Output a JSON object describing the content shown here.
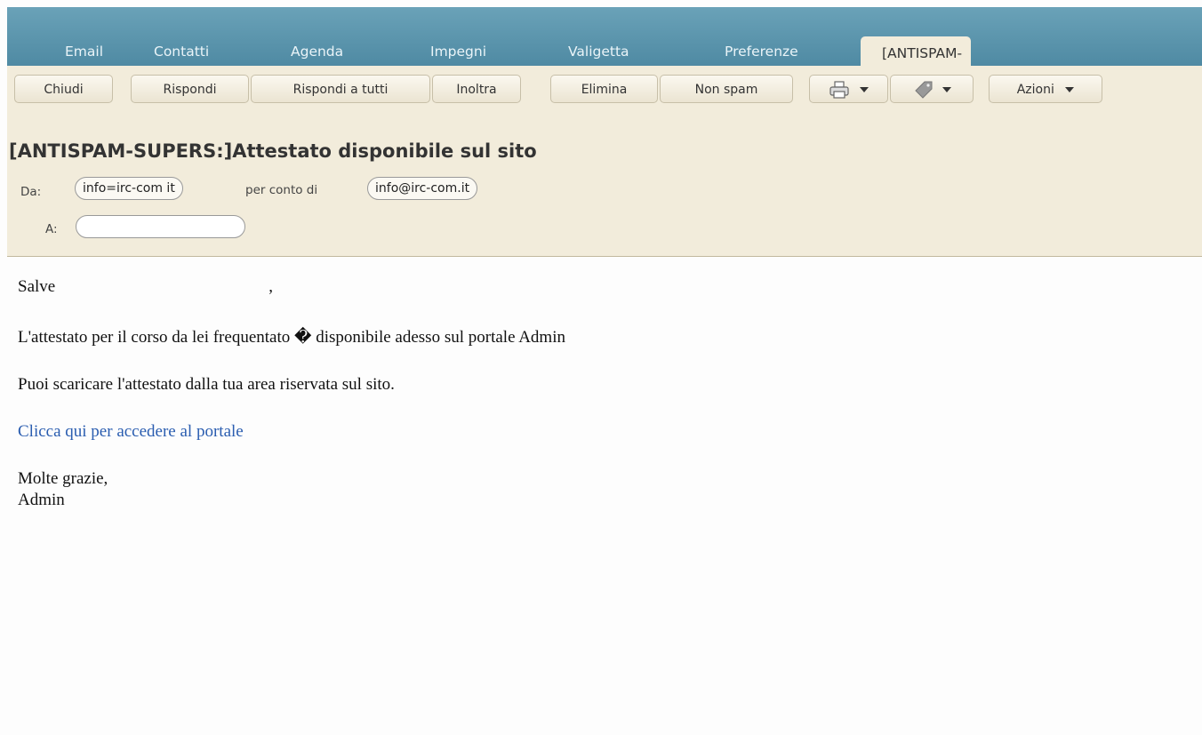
{
  "tabs": [
    {
      "label": "Email"
    },
    {
      "label": "Contatti"
    },
    {
      "label": "Agenda"
    },
    {
      "label": "Impegni"
    },
    {
      "label": "Valigetta"
    },
    {
      "label": "Preferenze"
    }
  ],
  "active_tab": {
    "label": "[ANTISPAM-SUPER"
  },
  "toolbar": {
    "close": "Chiudi",
    "reply": "Rispondi",
    "reply_all": "Rispondi a tutti",
    "forward": "Inoltra",
    "delete": "Elimina",
    "not_spam": "Non spam",
    "print_icon": "printer-icon",
    "tag_icon": "tag-icon",
    "actions": "Azioni"
  },
  "message": {
    "subject": "[ANTISPAM-SUPERS:]Attestato disponibile sul sito",
    "from_label": "Da:",
    "from": "info=irc-com it",
    "on_behalf_label": "per conto di",
    "on_behalf": "info@irc-com.it",
    "to_label": "A:",
    "to": ""
  },
  "body": {
    "greeting": "Salve",
    "greeting_comma": ",",
    "line1": "L'attestato per il corso da lei frequentato � disponibile adesso sul portale Admin",
    "line2": "Puoi scaricare l'attestato dalla tua area riservata sul sito.",
    "link": "Clicca qui per accedere al portale",
    "closing": "Molte grazie,",
    "signature": "Admin"
  },
  "colors": {
    "header_band": "#5b95ad",
    "toolbar_bg": "#f2ecdb",
    "link": "#2a5db0"
  }
}
